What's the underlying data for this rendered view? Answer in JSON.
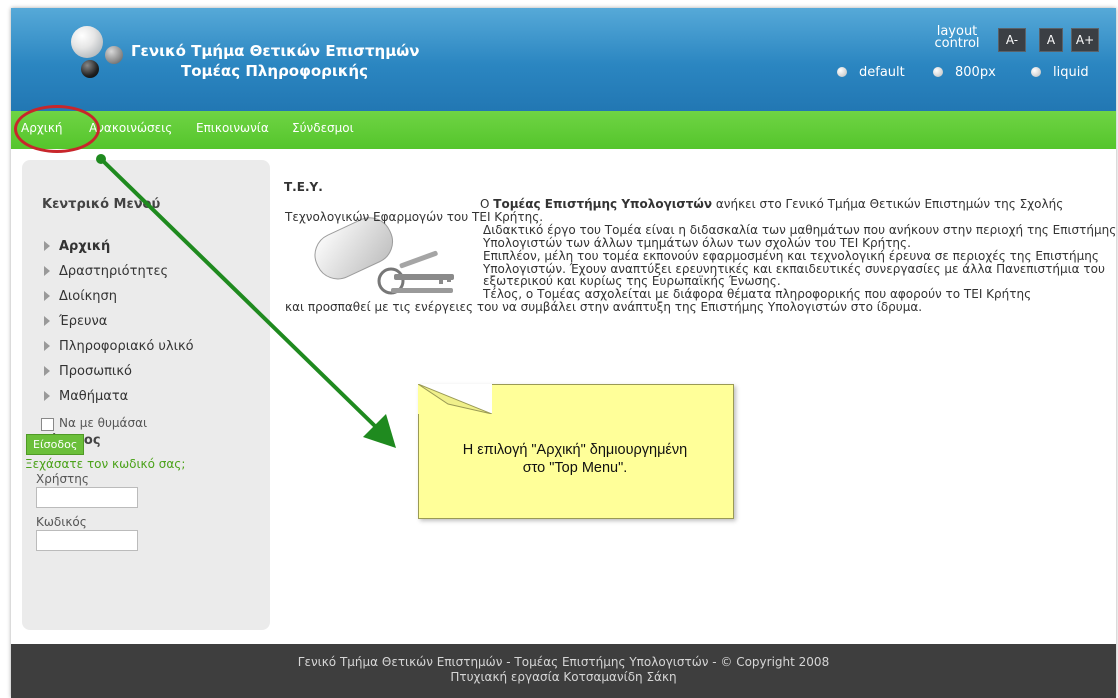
{
  "header": {
    "title_line1": "Γενικό Τμήμα Θετικών Επιστημών",
    "title_line2": "Τομέας Πληροφορικής",
    "layout_control_line1": "layout",
    "layout_control_line2": "control",
    "font_buttons": [
      "A-",
      "A",
      "A+"
    ],
    "layout_options": [
      "default",
      "800px",
      "liquid"
    ]
  },
  "topmenu": {
    "items": [
      "Αρχική",
      "Ανακοινώσεις",
      "Επικοινωνία",
      "Σύνδεσμοι"
    ]
  },
  "sidebar": {
    "menu_title": "Κεντρικό Μενού",
    "items": [
      {
        "label": "Αρχική",
        "active": true
      },
      {
        "label": "Δραστηριότητες",
        "active": false
      },
      {
        "label": "Διοίκηση",
        "active": false
      },
      {
        "label": "Έρευνα",
        "active": false
      },
      {
        "label": "Πληροφοριακό υλικό",
        "active": false
      },
      {
        "label": "Προσωπικό",
        "active": false
      },
      {
        "label": "Μαθήματα",
        "active": false
      }
    ],
    "login": {
      "title": "Είσοδος",
      "username_label": "Χρήστης",
      "username_value": "",
      "password_label": "Κωδικός",
      "password_value": "",
      "remember_label": "Να με θυμάσαι",
      "remember_checked": false,
      "submit_label": "Είσοδος",
      "forgot_label": "Ξεχάσατε τον κωδικό σας;"
    }
  },
  "content": {
    "title": "Τ.Ε.Υ.",
    "para1_prefix": "Ο ",
    "para1_bold": "Τομέας Επιστήμης Υπολογιστών",
    "para1_rest": " ανήκει στο Γενικό Τμήμα Θετικών Επιστημών της Σχολής Τεχνολογικών Εφαρμογών του ΤΕΙ Κρήτης.",
    "para2": "Διδακτικό έργο του Τομέα είναι η διδασκαλία των μαθημάτων που ανήκουν στην περιοχή της Επιστήμης Υπολογιστών των άλλων τμημάτων όλων των σχολών του ΤΕΙ Κρήτης.",
    "para3": "Επιπλέον, μέλη του τομέα εκπονούν εφαρμοσμένη και τεχνολογική έρευνα σε περιοχές της Επιστήμης Υπολογιστών. Έχουν αναπτύξει ερευνητικές και εκπαιδευτικές συνεργασίες με άλλα Πανεπιστήμια του εξωτερικού και κυρίως της Ευρωπαϊκής Ένωσης.",
    "para4_line1": "Τέλος, ο Τομέας ασχολείται με διάφορα θέματα πληροφορικής που αφορούν το ΤΕΙ Κρήτης",
    "para4_line2": "και προσπαθεί με τις ενέργειες του να συμβάλει στην ανάπτυξη της Επιστήμης Υπολογιστών στο ίδρυμα."
  },
  "callout": {
    "line1": "Η επιλογή \"Αρχική\" δημιουργημένη",
    "line2": "στο \"Top Menu\"."
  },
  "footer": {
    "line1": "Γενικό Τμήμα Θετικών Επιστημών - Τομέας Επιστήμης Υπολογιστών - © Copyright 2008",
    "line2": "Πτυχιακή εργασία Κοτσαμανίδη Σάκη"
  },
  "colors": {
    "header_blue": "#2b86c1",
    "menu_green": "#55c52c",
    "annotation_red": "#c8262b",
    "annotation_arrow_green": "#1f8a1f",
    "callout_yellow": "#ffff99",
    "footer_dark": "#3e3e3e"
  }
}
